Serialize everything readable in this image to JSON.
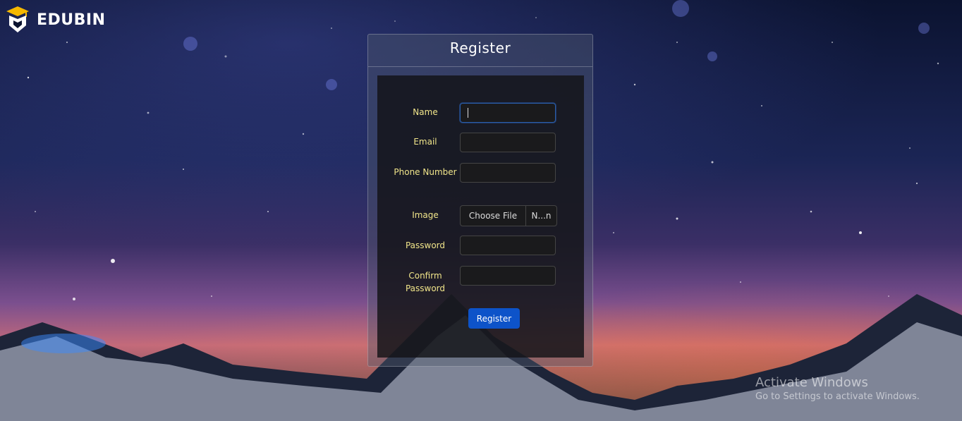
{
  "brand": {
    "name": "EDUBIN",
    "icon": "graduation-cap-shield-icon"
  },
  "form": {
    "title": "Register",
    "fields": [
      {
        "label": "Name",
        "value": "",
        "focused": true
      },
      {
        "label": "Email",
        "value": ""
      },
      {
        "label": "Phone Number",
        "value": ""
      },
      {
        "label": "Image",
        "file_button": "Choose File",
        "file_name": "N...n"
      },
      {
        "label": "Password",
        "value": ""
      },
      {
        "label": "Confirm Password",
        "value": ""
      }
    ],
    "submit_label": "Register"
  },
  "watermark": {
    "line1": "Activate Windows",
    "line2": "Go to Settings to activate Windows."
  },
  "colors": {
    "label": "#f1e58a",
    "button": "#0d53c9",
    "focus_border": "#2a5ca8"
  }
}
